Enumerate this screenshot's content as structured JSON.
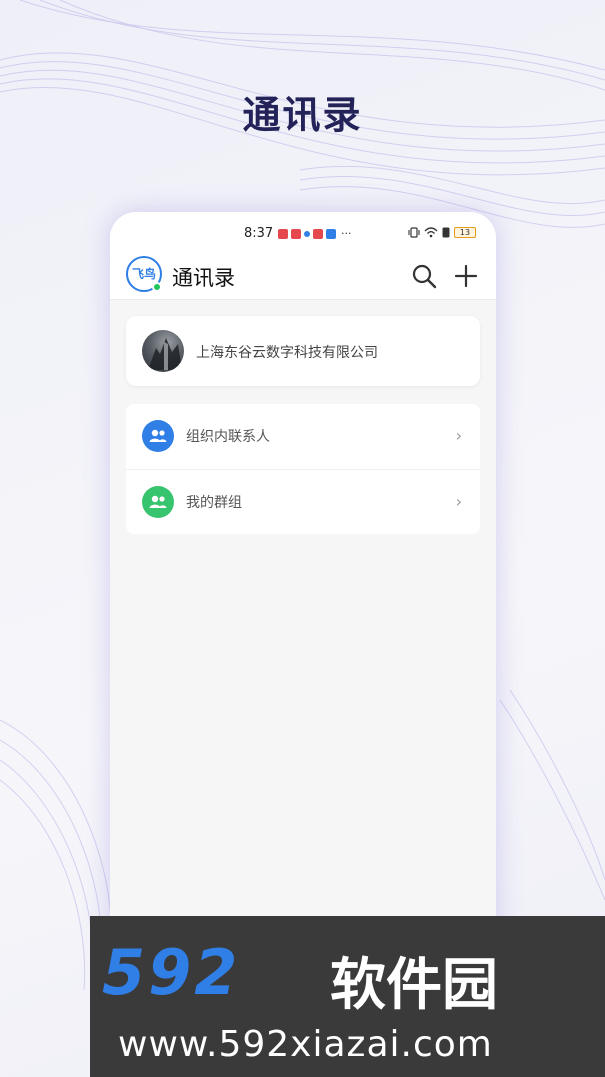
{
  "promo": {
    "title": "通讯录"
  },
  "status_bar": {
    "time": "8:37",
    "battery": "13",
    "more": "···",
    "notification_colors": [
      "#e5484d",
      "#e5484d",
      "#2f7fe6",
      "#e5484d",
      "#2f7fe6"
    ]
  },
  "header": {
    "logo_text": "飞鸟",
    "title": "通讯录",
    "search_icon": "search-icon",
    "add_icon": "plus-icon"
  },
  "org": {
    "name": "上海东谷云数字科技有限公司"
  },
  "list": [
    {
      "label": "组织内联系人",
      "icon": "people-icon",
      "color": "#2f7fe6"
    },
    {
      "label": "我的群组",
      "icon": "group-icon",
      "color": "#37c46e"
    }
  ],
  "watermark": {
    "brand_digits": "592",
    "brand_cn": "软件园",
    "url": "www.592xiazai.com"
  },
  "colors": {
    "accent": "#2f7fe6",
    "online": "#22c55e",
    "title": "#23235a"
  }
}
